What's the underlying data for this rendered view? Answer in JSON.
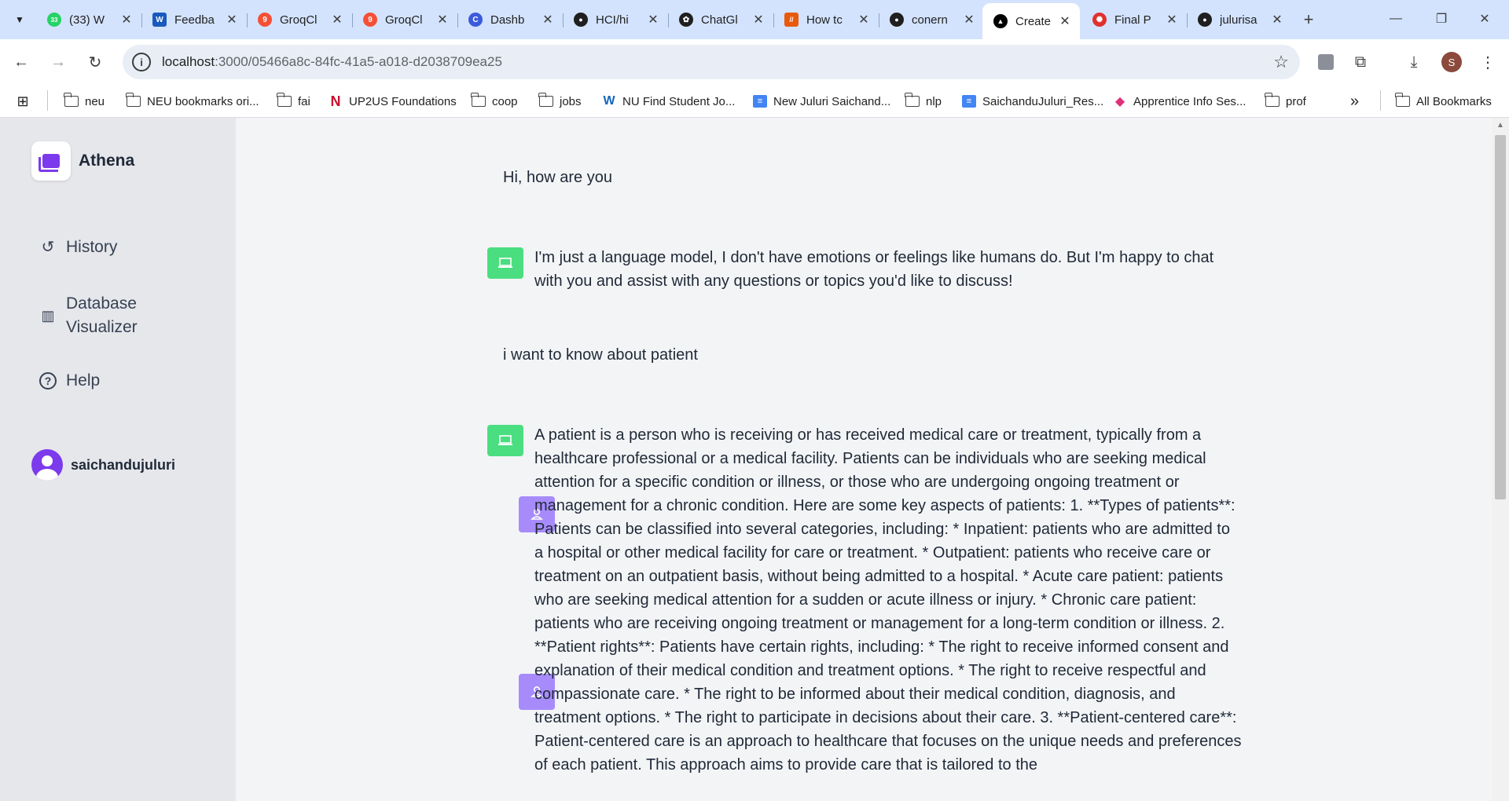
{
  "tabs": [
    {
      "label": "(33) W",
      "favicon": "whatsapp-icon",
      "color": "#25d366",
      "glyph": "33"
    },
    {
      "label": "Feedba",
      "favicon": "word-icon",
      "color": "#185abd",
      "glyph": "W"
    },
    {
      "label": "GroqCl",
      "favicon": "groq-icon",
      "color": "#f55036",
      "glyph": "9"
    },
    {
      "label": "GroqCl",
      "favicon": "groq-icon",
      "color": "#f55036",
      "glyph": "9"
    },
    {
      "label": "Dashb",
      "favicon": "dashboard-icon",
      "color": "#3b5bdb",
      "glyph": "C"
    },
    {
      "label": "HCI/hi",
      "favicon": "github-icon",
      "color": "#1f1f1f",
      "glyph": "●"
    },
    {
      "label": "ChatGl",
      "favicon": "chatgpt-icon",
      "color": "#1f1f1f",
      "glyph": "✿"
    },
    {
      "label": "How tc",
      "favicon": "slashes-icon",
      "color": "#e8590c",
      "glyph": "//"
    },
    {
      "label": "conern",
      "favicon": "github-icon",
      "color": "#1f1f1f",
      "glyph": "●"
    },
    {
      "label": "Create",
      "favicon": "vercel-icon",
      "color": "#000000",
      "glyph": "▲"
    },
    {
      "label": "Final P",
      "favicon": "app-icon",
      "color": "#e03131",
      "glyph": "✺"
    },
    {
      "label": "julurisa",
      "favicon": "github-icon",
      "color": "#1f1f1f",
      "glyph": "●"
    }
  ],
  "browser": {
    "url_host": "localhost",
    "url_path": ":3000/05466a8c-84fc-41a5-a018-d2038709ea25",
    "profile_initial": "S"
  },
  "bookmarks": [
    {
      "label": "neu",
      "icon": "folder-icon"
    },
    {
      "label": "NEU bookmarks ori...",
      "icon": "folder-icon"
    },
    {
      "label": "fai",
      "icon": "folder-icon"
    },
    {
      "label": "UP2US Foundations",
      "icon": "n-logo-icon"
    },
    {
      "label": "coop",
      "icon": "folder-icon"
    },
    {
      "label": "jobs",
      "icon": "folder-icon"
    },
    {
      "label": "NU Find Student Jo...",
      "icon": "w-logo-icon"
    },
    {
      "label": "New Juluri Saichand...",
      "icon": "doc-icon"
    },
    {
      "label": "nlp",
      "icon": "folder-icon"
    },
    {
      "label": "SaichanduJuluri_Res...",
      "icon": "doc-icon"
    },
    {
      "label": "Apprentice Info Ses...",
      "icon": "app-logo-icon"
    },
    {
      "label": "prof",
      "icon": "folder-icon"
    }
  ],
  "bookmarks_more": "»",
  "bookmarks_all": "All Bookmarks",
  "app": {
    "name": "Athena",
    "nav": [
      {
        "label": "History",
        "icon": "history-icon"
      },
      {
        "label": "Database Visualizer",
        "icon": "chart-icon"
      },
      {
        "label": "Help",
        "icon": "help-icon"
      }
    ],
    "username": "saichandujuluri"
  },
  "messages": [
    {
      "role": "user",
      "text": "Hi, how are you"
    },
    {
      "role": "bot",
      "text": "I'm just a language model, I don't have emotions or feelings like humans do. But I'm happy to chat with you and assist with any questions or topics you'd like to discuss!"
    },
    {
      "role": "user",
      "text": "i want to know about patient"
    },
    {
      "role": "bot",
      "text": "A patient is a person who is receiving or has received medical care or treatment, typically from a healthcare professional or a medical facility. Patients can be individuals who are seeking medical attention for a specific condition or illness, or those who are undergoing ongoing treatment or management for a chronic condition. Here are some key aspects of patients: 1. **Types of patients**: Patients can be classified into several categories, including: * Inpatient: patients who are admitted to a hospital or other medical facility for care or treatment. * Outpatient: patients who receive care or treatment on an outpatient basis, without being admitted to a hospital. * Acute care patient: patients who are seeking medical attention for a sudden or acute illness or injury. * Chronic care patient: patients who are receiving ongoing treatment or management for a long-term condition or illness. 2. **Patient rights**: Patients have certain rights, including: * The right to receive informed consent and explanation of their medical condition and treatment options. * The right to receive respectful and compassionate care. * The right to be informed about their medical condition, diagnosis, and treatment options. * The right to participate in decisions about their care. 3. **Patient-centered care**: Patient-centered care is an approach to healthcare that focuses on the unique needs and preferences of each patient. This approach aims to provide care that is tailored to the"
    }
  ],
  "colors": {
    "accent": "#7c3aed",
    "user_icon": "#a78bfa",
    "bot_icon": "#4ade80",
    "sidebar_bg": "#e5e7eb",
    "main_bg": "#f3f4f6"
  }
}
